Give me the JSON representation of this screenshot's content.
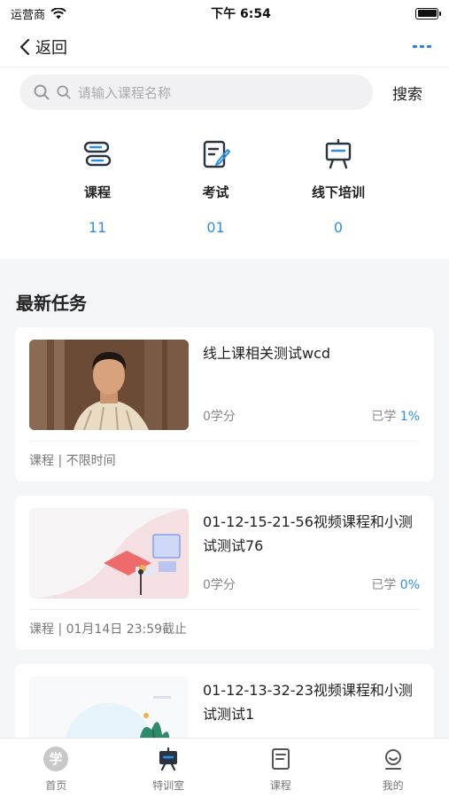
{
  "status_bar": {
    "carrier": "运营商",
    "time": "下午 6:54"
  },
  "nav": {
    "back_label": "返回"
  },
  "search": {
    "placeholder": "请输入课程名称",
    "button_label": "搜索"
  },
  "stats": [
    {
      "label": "课程",
      "value": "11",
      "icon": "course-stack-icon"
    },
    {
      "label": "考试",
      "value": "01",
      "icon": "exam-edit-icon"
    },
    {
      "label": "线下培训",
      "value": "0",
      "icon": "easel-board-icon"
    }
  ],
  "section_title": "最新任务",
  "tasks": [
    {
      "title": "线上课相关测试wcd",
      "credits": "0学分",
      "studied_label": "已学",
      "studied_pct": "1%",
      "footer": "课程 | 不限时间",
      "thumb": "portrait-photo"
    },
    {
      "title": "01-12-15-21-56视频课程和小测试测试76",
      "credits": "0学分",
      "studied_label": "已学",
      "studied_pct": "0%",
      "footer": "课程 | 01月14日 23:59截止",
      "thumb": "isometric-illustration"
    },
    {
      "title": "01-12-13-32-23视频课程和小测试测试1",
      "credits": "",
      "studied_label": "",
      "studied_pct": "",
      "footer": "",
      "thumb": "plant-illustration"
    }
  ],
  "tabbar": [
    {
      "label": "首页",
      "icon": "home-xue-icon",
      "active": false
    },
    {
      "label": "特训室",
      "icon": "training-room-icon",
      "active": true
    },
    {
      "label": "课程",
      "icon": "course-book-icon",
      "active": false
    },
    {
      "label": "我的",
      "icon": "profile-icon",
      "active": false
    }
  ],
  "colors": {
    "accent": "#2d8ee8",
    "nav_accent": "#2d7be5",
    "background": "#f4f5f7"
  }
}
